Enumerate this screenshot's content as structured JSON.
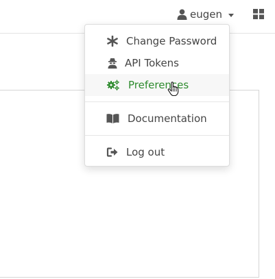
{
  "header": {
    "username": "eugen",
    "icons": {
      "user": "user-icon",
      "apps": "apps-grid-icon",
      "caret": "caret-down-icon"
    }
  },
  "user_menu": {
    "items": [
      {
        "label": "Change Password",
        "icon": "asterisk-icon"
      },
      {
        "label": "API Tokens",
        "icon": "user-secret-icon"
      },
      {
        "label": "Preferences",
        "icon": "cogs-icon",
        "state": "hovered"
      },
      {
        "label": "Documentation",
        "icon": "book-open-icon"
      },
      {
        "label": "Log out",
        "icon": "sign-out-icon"
      }
    ]
  },
  "colors": {
    "hover_text": "#2e8b2e",
    "hover_bg": "#f7f7f7",
    "text": "#444444"
  }
}
